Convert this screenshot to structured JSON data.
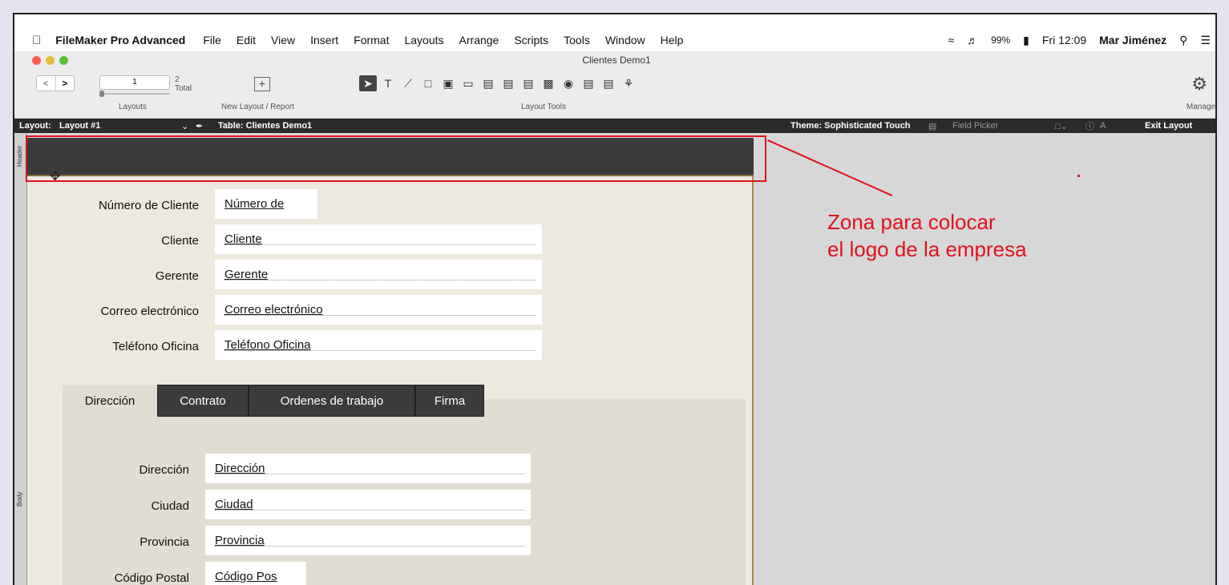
{
  "menubar": {
    "app_name": "FileMaker Pro Advanced",
    "items": [
      "File",
      "Edit",
      "View",
      "Insert",
      "Format",
      "Layouts",
      "Arrange",
      "Scripts",
      "Tools",
      "Window",
      "Help"
    ],
    "battery": "99%",
    "clock": "Fri 12:09",
    "user": "Mar Jiménez"
  },
  "window": {
    "title": "Clientes Demo1"
  },
  "toolbar": {
    "record_number": "1",
    "total_count": "2",
    "total_label": "Total",
    "layouts_label": "Layouts",
    "new_layout_label": "New Layout / Report",
    "layout_tools_label": "Layout Tools",
    "manage_label": "Manage"
  },
  "layoutbar": {
    "layout_prefix": "Layout:",
    "layout_name": "Layout #1",
    "table_label": "Table: Clientes Demo1",
    "theme_label": "Theme: Sophisticated Touch",
    "field_picker": "Field Picker",
    "exit_layout": "Exit Layout"
  },
  "parts": {
    "header": "Header",
    "body": "Body"
  },
  "fields": [
    {
      "label": "Número de Cliente",
      "value": "Número de"
    },
    {
      "label": "Cliente",
      "value": "Cliente"
    },
    {
      "label": "Gerente",
      "value": "Gerente"
    },
    {
      "label": "Correo electrónico",
      "value": "Correo electrónico"
    },
    {
      "label": "Teléfono Oficina",
      "value": "Teléfono Oficina"
    }
  ],
  "tabs": [
    "Dirección",
    "Contrato",
    "Ordenes de trabajo",
    "Firma"
  ],
  "tab_fields": [
    {
      "label": "Dirección",
      "value": "Dirección"
    },
    {
      "label": "Ciudad",
      "value": "Ciudad"
    },
    {
      "label": "Provincia",
      "value": "Provincia"
    },
    {
      "label": "Código Postal",
      "value": "Código Pos"
    }
  ],
  "annotation": {
    "line1": "Zona para colocar",
    "line2": "el logo de la empresa"
  },
  "colors": {
    "accent_red": "#e2121b",
    "header_part": "#3b3b3e",
    "body_part": "#eee9df"
  }
}
